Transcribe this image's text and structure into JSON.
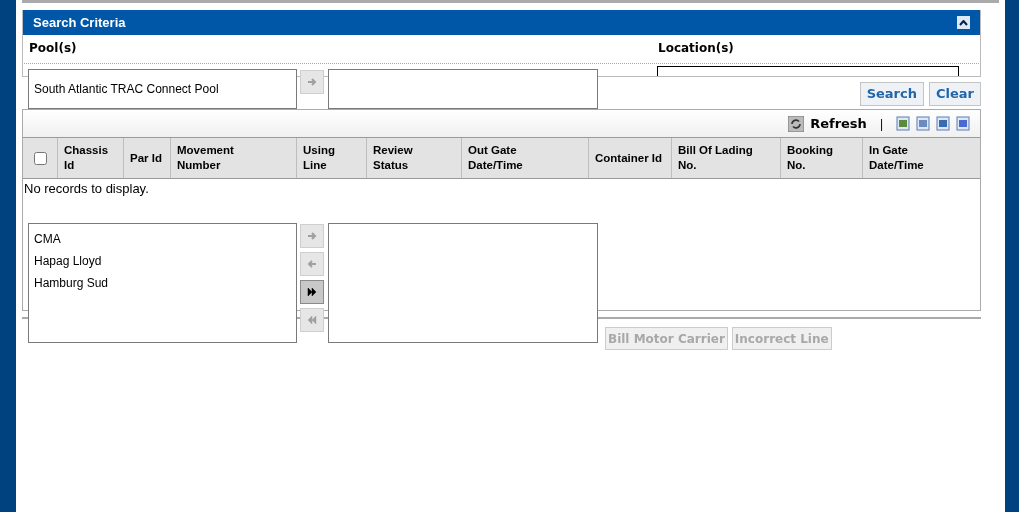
{
  "search_panel": {
    "title": "Search Criteria",
    "expanded": true,
    "pools_label": "Pool(s)",
    "locations_label": "Location(s)"
  },
  "pool_shuttle": {
    "items": [
      "South Atlantic TRAC Connect Pool"
    ],
    "moves": [
      {
        "kind": "add",
        "enabled": false
      }
    ]
  },
  "search_buttons": [
    "Search",
    "Clear"
  ],
  "grid": {
    "refresh": "Refresh",
    "separator": "|",
    "select_all_checked": false,
    "columns": [
      {
        "label": "Chassis Id"
      },
      {
        "label": "Par Id"
      },
      {
        "label": "Movement Number"
      },
      {
        "label": "Using Line"
      },
      {
        "label": "Review Status"
      },
      {
        "label": "Out Gate Date/Time"
      },
      {
        "label": "Container Id"
      },
      {
        "label": "Bill Of Lading No."
      },
      {
        "label": "Booking No."
      },
      {
        "label": "In Gate Date/Time"
      }
    ],
    "empty_message": "No records to display."
  },
  "line_shuttle": {
    "items": [
      "CMA",
      "Hapag Lloyd",
      "Hamburg Sud"
    ],
    "moves": [
      {
        "kind": "add",
        "enabled": false
      },
      {
        "kind": "remove",
        "enabled": false
      },
      {
        "kind": "add_all",
        "enabled": true
      },
      {
        "kind": "remove_all",
        "enabled": false
      }
    ]
  },
  "actions": [
    {
      "label": "Bill Motor Carrier",
      "disabled": true
    },
    {
      "label": "Incorrect Line",
      "disabled": true
    }
  ]
}
